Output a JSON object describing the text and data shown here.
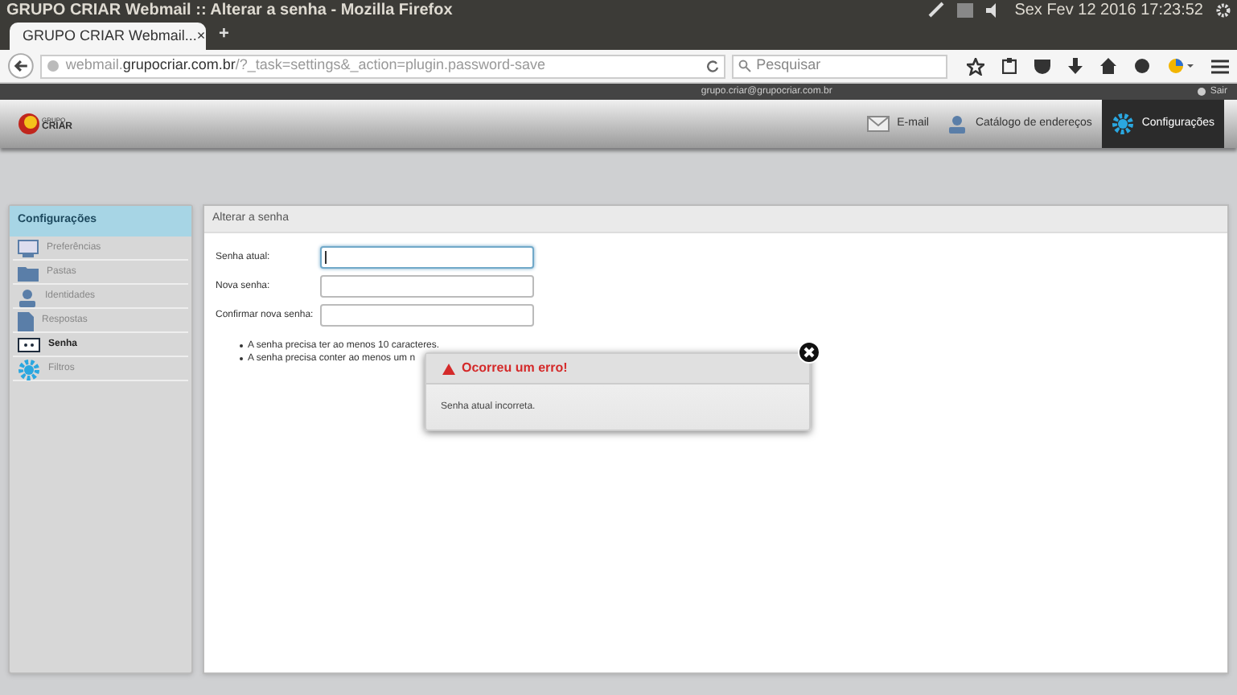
{
  "window": {
    "title": "GRUPO CRIAR Webmail :: Alterar a senha - Mozilla Firefox"
  },
  "system_tray": {
    "clock": "Sex Fev 12 2016 17:23:52"
  },
  "tabs": [
    {
      "label": "GRUPO CRIAR Webmail...",
      "selected": true,
      "close": "×"
    }
  ],
  "new_tab": "+",
  "address_bar": {
    "prefix": "webmail.",
    "domain": "grupocriar.com.br",
    "path": "/?_task=settings&_action=plugin.password-save"
  },
  "search": {
    "placeholder": "Pesquisar"
  },
  "topbar": {
    "user": "grupo.criar@grupocriar.com.br",
    "logout": "Sair"
  },
  "logo": {
    "line1": "GRUPO",
    "line2": "CRIAR"
  },
  "nav": [
    {
      "label": "E-mail",
      "kind": "mail",
      "selected": false
    },
    {
      "label": "Catálogo de endereços",
      "kind": "person",
      "selected": false
    },
    {
      "label": "Configurações",
      "kind": "gear",
      "selected": true
    }
  ],
  "sidebar": {
    "title": "Configurações",
    "items": [
      {
        "label": "Preferências",
        "kind": "monitor",
        "selected": false
      },
      {
        "label": "Pastas",
        "kind": "folder",
        "selected": false
      },
      {
        "label": "Identidades",
        "kind": "person",
        "selected": false
      },
      {
        "label": "Respostas",
        "kind": "doc",
        "selected": false
      },
      {
        "label": "Senha",
        "kind": "key",
        "selected": true
      },
      {
        "label": "Filtros",
        "kind": "gear",
        "selected": false
      }
    ]
  },
  "panel": {
    "title": "Alterar a senha",
    "fields": [
      {
        "label": "Senha atual:",
        "focused": true
      },
      {
        "label": "Nova senha:",
        "focused": false
      },
      {
        "label": "Confirmar nova senha:",
        "focused": false
      }
    ],
    "rules": [
      "A senha precisa ter ao menos 10 caracteres.",
      "A senha precisa conter ao menos um n"
    ]
  },
  "dialog": {
    "title": "Ocorreu um erro!",
    "message": "Senha atual incorreta."
  }
}
